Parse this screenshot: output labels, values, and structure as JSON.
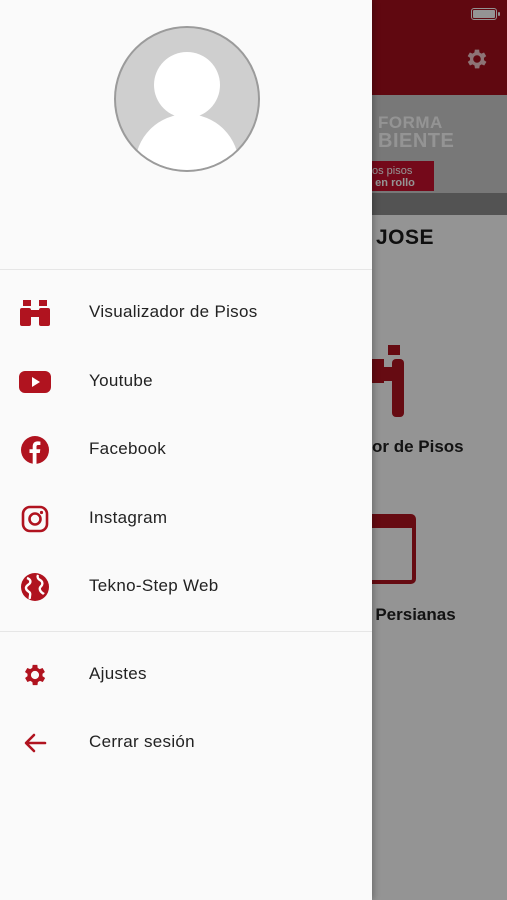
{
  "background": {
    "greeting": "JOSE",
    "banner_line1": "FORMA",
    "banner_line2": "BIENTE",
    "banner_tag1": "os pisos",
    "banner_tag2": "s en rollo",
    "card1_label": "or de Pisos",
    "card2_label": "r Persianas"
  },
  "drawer": {
    "items": [
      {
        "label": "Visualizador de Pisos",
        "icon": "binoculars-icon"
      },
      {
        "label": "Youtube",
        "icon": "youtube-icon"
      },
      {
        "label": "Facebook",
        "icon": "facebook-icon"
      },
      {
        "label": "Instagram",
        "icon": "instagram-icon"
      },
      {
        "label": "Tekno-Step Web",
        "icon": "globe-icon"
      }
    ],
    "settings": [
      {
        "label": "Ajustes",
        "icon": "gear-icon"
      },
      {
        "label": "Cerrar sesión",
        "icon": "arrow-left-icon"
      }
    ]
  },
  "colors": {
    "accent": "#b0131f",
    "header": "#a50f1d",
    "text": "#222222"
  }
}
